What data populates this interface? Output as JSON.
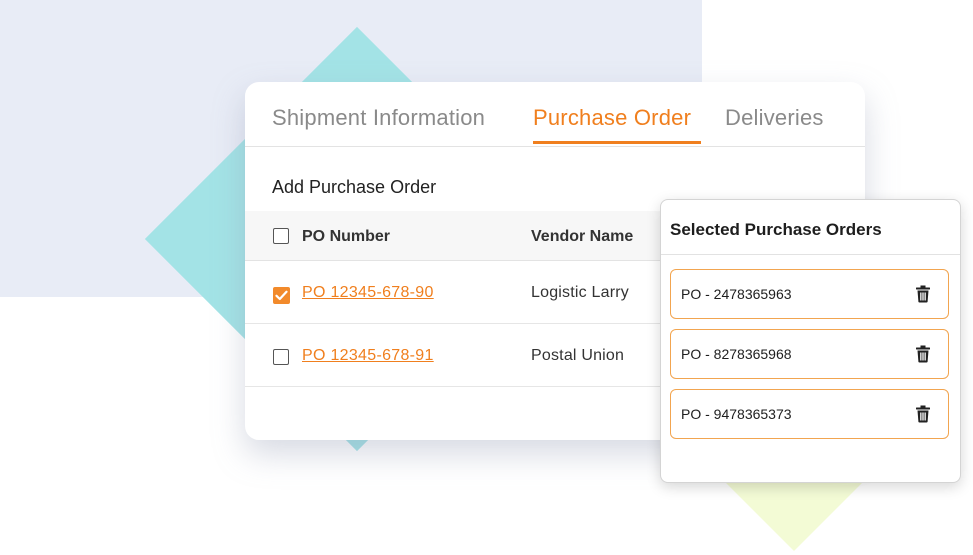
{
  "tabs": [
    {
      "label": "Shipment Information",
      "active": false
    },
    {
      "label": "Purchase Order",
      "active": true
    },
    {
      "label": "Deliveries",
      "active": false
    }
  ],
  "section_title": "Add Purchase Order",
  "table": {
    "headers": [
      "PO Number",
      "Vendor Name"
    ],
    "rows": [
      {
        "po_number": "PO 12345-678-90",
        "vendor": "Logistic Larry",
        "checked": true
      },
      {
        "po_number": "PO 12345-678-91",
        "vendor": "Postal Union",
        "checked": false
      }
    ]
  },
  "selected_panel": {
    "title": "Selected Purchase Orders",
    "items": [
      {
        "label": "PO - 2478365963",
        "icon": "trash-icon"
      },
      {
        "label": "PO - 8278365968",
        "icon": "trash-icon"
      },
      {
        "label": "PO - 9478365373",
        "icon": "trash-icon"
      }
    ]
  },
  "colors": {
    "accent": "#f07f1e",
    "checkbox_checked": "#f28a2b",
    "background_block": "#e8ecf6",
    "teal_shape": "#a3e3e6",
    "yellow_shape": "#f3fbd5",
    "item_border": "#f2a550"
  }
}
